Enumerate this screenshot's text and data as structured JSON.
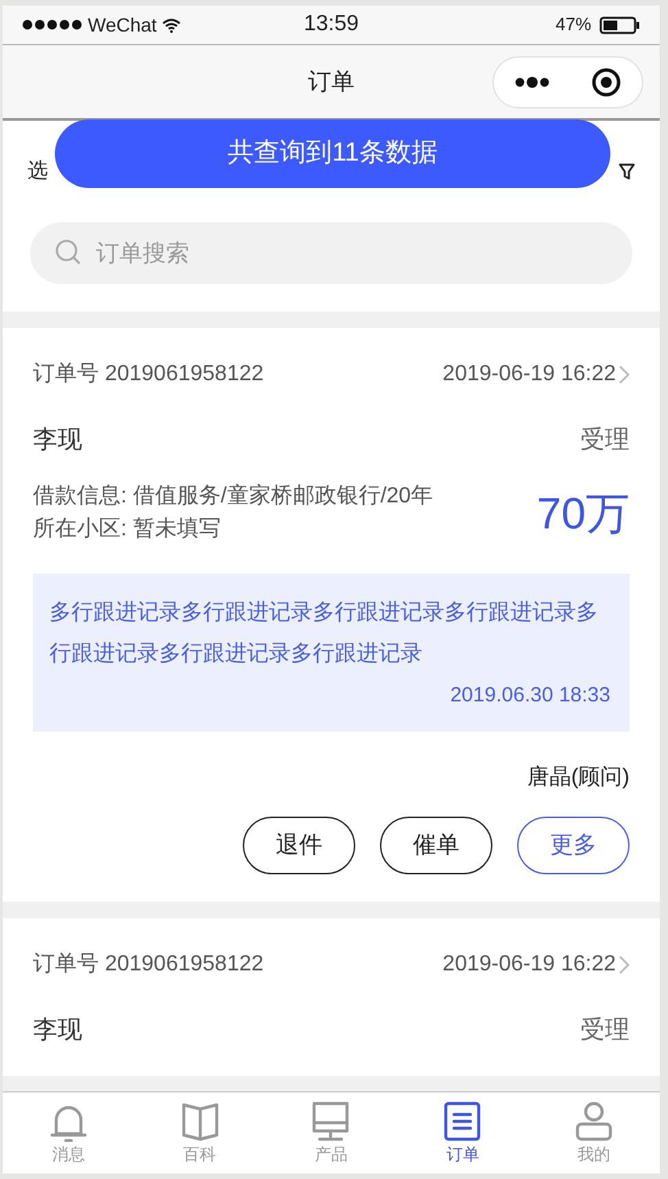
{
  "status_bar": {
    "carrier": "WeChat",
    "time": "13:59",
    "battery": "47%"
  },
  "nav_bar": {
    "title": "订单"
  },
  "filter_bar": {
    "label": "选"
  },
  "toast": {
    "text": "共查询到11条数据"
  },
  "search": {
    "placeholder": "订单搜索"
  },
  "orders": [
    {
      "order_label": "订单号",
      "order_no": "2019061958122",
      "date": "2019-06-19 16:22",
      "name": "李现",
      "status": "受理",
      "loan_info": "借款信息: 借值服务/童家桥邮政银行/20年",
      "community": "所在小区: 暂未填写",
      "amount": "70万",
      "followup": {
        "text": "多行跟进记录多行跟进记录多行跟进记录多行跟进记录多行跟进记录多行跟进记录多行跟进记录",
        "time": "2019.06.30 18:33"
      },
      "advisor": "唐晶(顾问)",
      "actions": [
        {
          "label": "退件",
          "kind": "default"
        },
        {
          "label": "催单",
          "kind": "default"
        },
        {
          "label": "更多",
          "kind": "primary"
        }
      ]
    },
    {
      "order_label": "订单号",
      "order_no": "2019061958122",
      "date": "2019-06-19 16:22",
      "name": "李现",
      "status": "受理"
    }
  ],
  "tab_bar": [
    {
      "label": "消息",
      "kind": "bell",
      "selected": false
    },
    {
      "label": "百科",
      "kind": "book",
      "selected": false
    },
    {
      "label": "产品",
      "kind": "monitor",
      "selected": false
    },
    {
      "label": "订单",
      "kind": "list",
      "selected": true
    },
    {
      "label": "我的",
      "kind": "person",
      "selected": false
    }
  ]
}
